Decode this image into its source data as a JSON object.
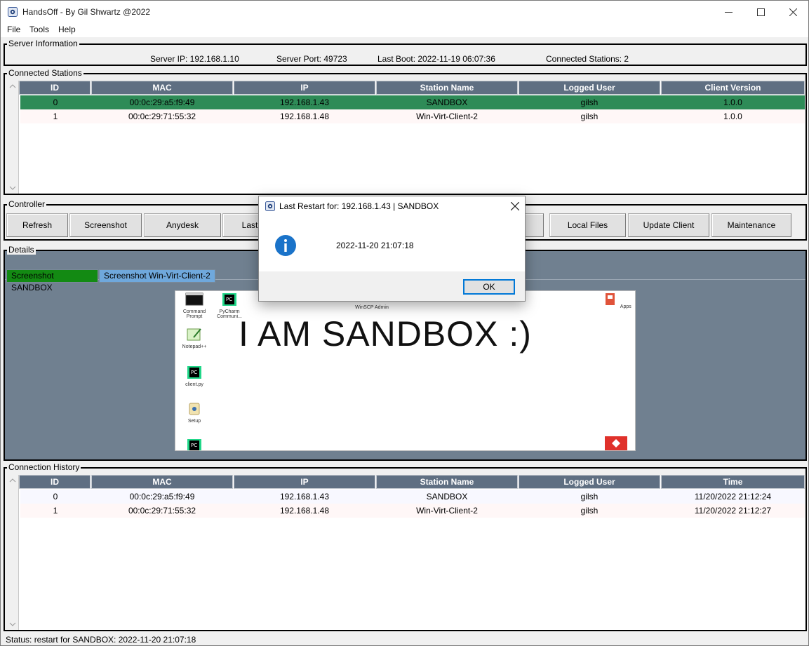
{
  "window": {
    "title": "HandsOff - By Gil Shwartz @2022"
  },
  "menu": [
    "File",
    "Tools",
    "Help"
  ],
  "server_info": {
    "legend": "Server Information",
    "ip": "Server IP: 192.168.1.10",
    "port": "Server Port: 49723",
    "boot": "Last Boot: 2022-11-19 06:07:36",
    "stations": "Connected Stations: 2"
  },
  "connected_stations": {
    "legend": "Connected Stations",
    "headers": [
      "ID",
      "MAC",
      "IP",
      "Station Name",
      "Logged User",
      "Client Version"
    ],
    "rows": [
      [
        "0",
        "00:0c:29:a5:f9:49",
        "192.168.1.43",
        "SANDBOX",
        "gilsh",
        "1.0.0"
      ],
      [
        "1",
        "00:0c:29:71:55:32",
        "192.168.1.48",
        "Win-Virt-Client-2",
        "gilsh",
        "1.0.0"
      ]
    ]
  },
  "controller": {
    "legend": "Controller",
    "buttons": [
      "Refresh",
      "Screenshot",
      "Anydesk",
      "Last",
      "Local Files",
      "Update Client",
      "Maintenance"
    ]
  },
  "details": {
    "legend": "Details",
    "tabs": [
      "Screenshot SANDBOX",
      "Screenshot Win-Virt-Client-2"
    ],
    "screenshot_text": "I AM SANDBOX :)",
    "desktop_icons": [
      "Command Prompt",
      "PyCharm Communi...",
      "Notepad++",
      "client.py",
      "Setup",
      "Apps",
      "WinSCP Admin"
    ]
  },
  "connection_history": {
    "legend": "Connection History",
    "headers": [
      "ID",
      "MAC",
      "IP",
      "Station Name",
      "Logged User",
      "Time"
    ],
    "rows": [
      [
        "0",
        "00:0c:29:a5:f9:49",
        "192.168.1.43",
        "SANDBOX",
        "gilsh",
        "11/20/2022 21:12:24"
      ],
      [
        "1",
        "00:0c:29:71:55:32",
        "192.168.1.48",
        "Win-Virt-Client-2",
        "gilsh",
        "11/20/2022 21:12:27"
      ]
    ]
  },
  "dialog": {
    "title": "Last Restart for: 192.168.1.43 | SANDBOX",
    "message": "2022-11-20 21:07:18",
    "ok_label": "OK",
    "icon": "info-icon"
  },
  "status": "Status: restart for SANDBOX: 2022-11-20 21:07:18",
  "colors": {
    "selected_row": "#2e8b57",
    "header_bg": "#5f6f82",
    "details_bg": "#708090",
    "tab_active": "#138a13",
    "tab_inactive": "#6fa8dc"
  }
}
